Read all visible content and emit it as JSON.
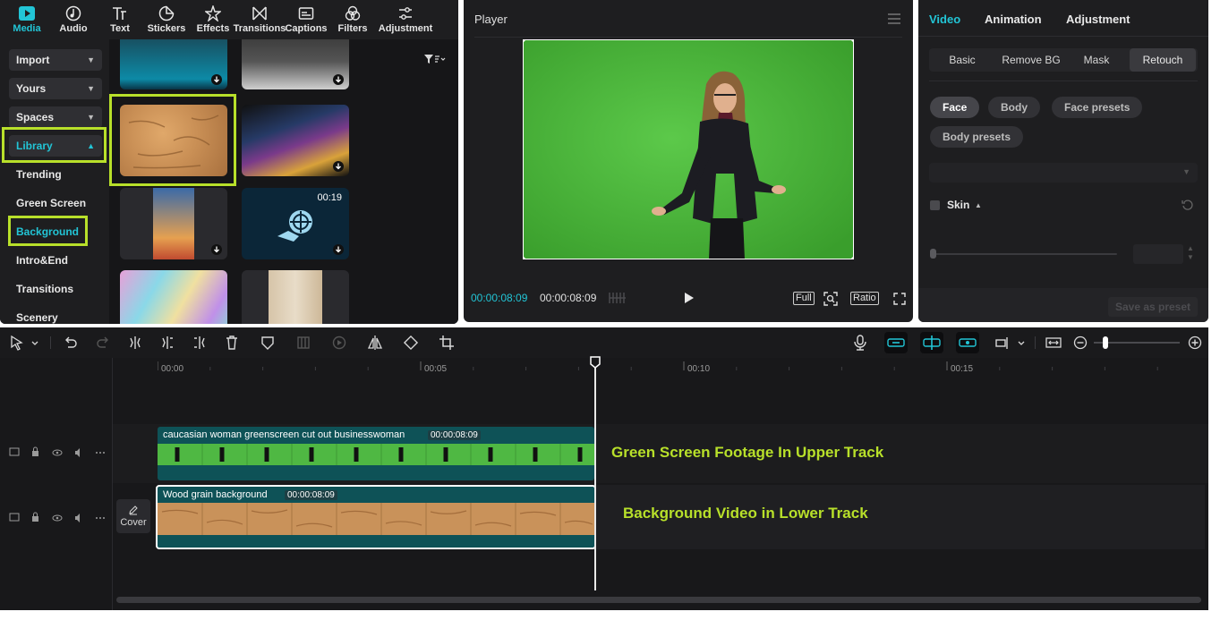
{
  "media_tabs": [
    {
      "label": "Media",
      "icon": "media-icon",
      "active": true
    },
    {
      "label": "Audio",
      "icon": "audio-icon"
    },
    {
      "label": "Text",
      "icon": "text-icon"
    },
    {
      "label": "Stickers",
      "icon": "stickers-icon"
    },
    {
      "label": "Effects",
      "icon": "effects-icon"
    },
    {
      "label": "Transitions",
      "icon": "transitions-icon"
    },
    {
      "label": "Captions",
      "icon": "captions-icon"
    },
    {
      "label": "Filters",
      "icon": "filters-icon"
    },
    {
      "label": "Adjustment",
      "icon": "adjustment-icon"
    }
  ],
  "sidebar": {
    "import": "Import",
    "yours": "Yours",
    "spaces": "Spaces",
    "library": "Library",
    "links": [
      "Trending",
      "Green Screen",
      "Background",
      "Intro&End",
      "Transitions",
      "Scenery"
    ]
  },
  "grid": {
    "duration_badge": "00:19"
  },
  "player": {
    "title": "Player",
    "current_time": "00:00:08:09",
    "total_time": "00:00:08:09",
    "full": "Full",
    "ratio": "Ratio"
  },
  "right_panel": {
    "tabs": [
      "Video",
      "Animation",
      "Adjustment"
    ],
    "subtabs": [
      "Basic",
      "Remove BG",
      "Mask",
      "Retouch"
    ],
    "pills": [
      "Face",
      "Body",
      "Face presets",
      "Body presets"
    ],
    "skin_label": "Skin",
    "save_preset": "Save as preset"
  },
  "timeline": {
    "ruler": [
      "00:00",
      "00:05",
      "00:10",
      "00:15"
    ],
    "upper_clip": {
      "title": "caucasian woman greenscreen cut out businesswoman",
      "duration": "00:00:08:09"
    },
    "lower_clip": {
      "title": "Wood grain background",
      "duration": "00:00:08:09"
    },
    "cover_label": "Cover",
    "annotation_upper": "Green Screen Footage In Upper Track",
    "annotation_lower": "Background Video in Lower Track"
  },
  "colors": {
    "accent": "#22c5d6",
    "highlight": "#b8e02a",
    "track_teal": "#0e5257",
    "green_screen": "#4ab43a"
  }
}
